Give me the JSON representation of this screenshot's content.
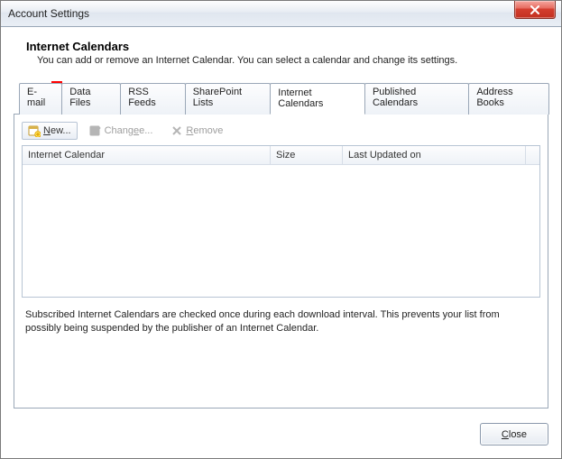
{
  "window": {
    "title": "Account Settings"
  },
  "header": {
    "title": "Internet Calendars",
    "description": "You can add or remove an Internet Calendar. You can select a calendar and change its settings."
  },
  "tabs": {
    "email": "E-mail",
    "dataFiles": "Data Files",
    "rssFeeds": "RSS Feeds",
    "sharepoint": "SharePoint Lists",
    "internetCalendars": "Internet Calendars",
    "publishedCalendars": "Published Calendars",
    "addressBooks": "Address Books"
  },
  "toolbar": {
    "newRest": "ew...",
    "change": "Chang",
    "changeRest": "e...",
    "remove": "Remove"
  },
  "grid": {
    "columns": {
      "name": "Internet Calendar",
      "size": "Size",
      "lastUpdated": "Last Updated on"
    },
    "rows": []
  },
  "footnote": "Subscribed Internet Calendars are checked once during each download interval. This prevents your list from possibly being suspended by the publisher of an Internet Calendar.",
  "buttons": {
    "closeRest": "lose"
  }
}
